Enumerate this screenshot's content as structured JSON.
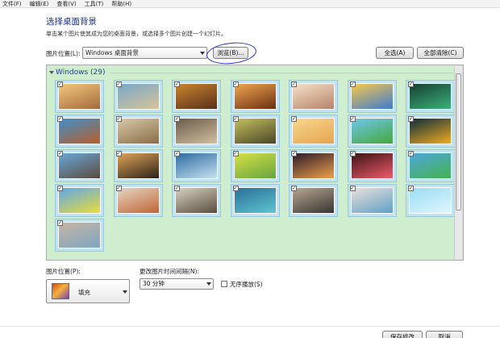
{
  "menu": [
    "文件(F)",
    "编辑(E)",
    "查看(V)",
    "工具(T)",
    "帮助(H)"
  ],
  "title": "选择桌面背景",
  "subtitle": "单击某个图片使其成为您的桌面背景，或选择多个图片创建一个幻灯片。",
  "picture_location": {
    "label": "图片位置(L):",
    "value": "Windows 桌面背景"
  },
  "buttons": {
    "browse": "浏览(B)...",
    "select_all": "全选(A)",
    "clear_all": "全部清除(C)",
    "save": "保存修改",
    "cancel": "取消"
  },
  "gallery": {
    "group_title": "Windows (29)",
    "check_mark": "✓",
    "tiles": [
      [
        "#f3c87b",
        "#a46a3d"
      ],
      [
        "#79a7c8",
        "#d6c49a"
      ],
      [
        "#c9862f",
        "#5a2f1a"
      ],
      [
        "#f1a650",
        "#6b2e12"
      ],
      [
        "#f5e1c8",
        "#b7836b"
      ],
      [
        "#f7c84a",
        "#3c7bd2"
      ],
      [
        "#153f31",
        "#3bb27a"
      ],
      [
        "#3e8fcb",
        "#b85f2a"
      ],
      [
        "#d8c9a8",
        "#8a6c48"
      ],
      [
        "#6a5a4a",
        "#d2c0a0"
      ],
      [
        "#c2c05d",
        "#4a4528"
      ],
      [
        "#f7d78e",
        "#e6a44f"
      ],
      [
        "#6fc6ec",
        "#45a83a"
      ],
      [
        "#0c2c3c",
        "#f1ac1f"
      ],
      [
        "#6aa8d8",
        "#5b4a3e"
      ],
      [
        "#e0a458",
        "#2c2218"
      ],
      [
        "#2c6ba0",
        "#c7e0f0"
      ],
      [
        "#d7e045",
        "#65a540"
      ],
      [
        "#2a1a2c",
        "#f0a048"
      ],
      [
        "#3a1414",
        "#ef5a6a"
      ],
      [
        "#4fa7dc",
        "#43b24e"
      ],
      [
        "#5fa6e8",
        "#e9dc3b"
      ],
      [
        "#e4d6c4",
        "#c26434"
      ],
      [
        "#d7d0c2",
        "#5a4e3e"
      ],
      [
        "#2a6f98",
        "#5ec5d0"
      ],
      [
        "#b5a792",
        "#3a3430"
      ],
      [
        "#e9e0d8",
        "#5fa0c8"
      ],
      [
        "#9bdcf2",
        "#dff6ff"
      ],
      [
        "#c6b4a4",
        "#7ea6c2"
      ]
    ]
  },
  "position": {
    "label": "图片位置(P):",
    "value": "填充"
  },
  "interval": {
    "label": "更改图片时间间隔(N):",
    "value": "30 分钟"
  },
  "shuffle": {
    "label": "无序播放(S)"
  }
}
